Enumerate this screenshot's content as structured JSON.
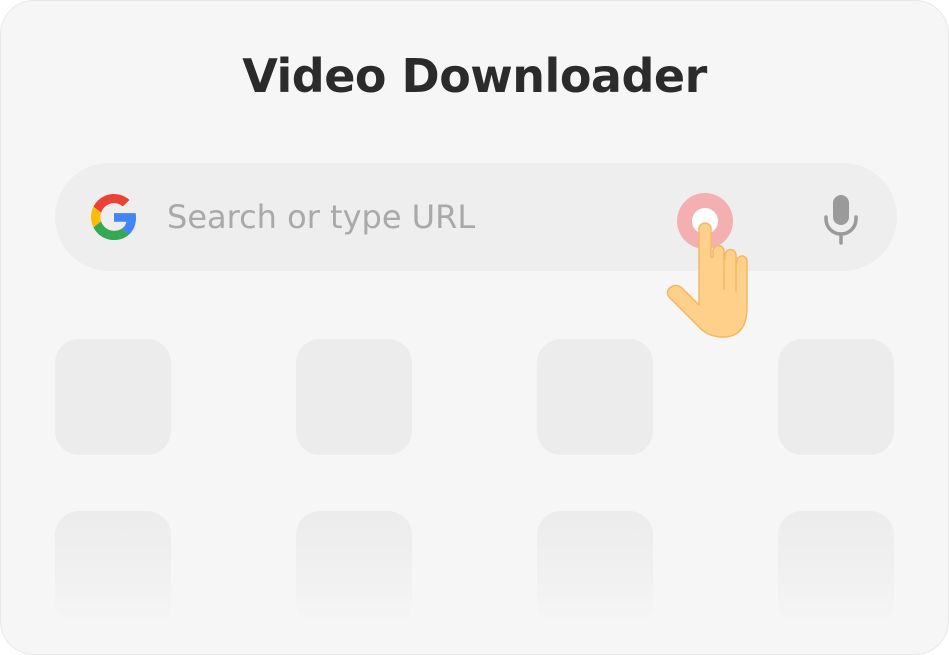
{
  "app": {
    "title": "Video Downloader"
  },
  "search": {
    "placeholder": "Search or type URL",
    "value": "",
    "leading_icon": "google-g-icon",
    "trailing_icon": "microphone-icon"
  },
  "tap_hint": {
    "icon": "hand-pointer-icon",
    "ring_color": "#f4a9a9",
    "hand_color": "#ffd08a"
  },
  "shortcuts": {
    "row1": [
      "",
      "",
      "",
      ""
    ],
    "row2": [
      "",
      "",
      "",
      ""
    ]
  },
  "colors": {
    "background": "#f6f6f6",
    "search_bar": "#eeeeee",
    "tile": "#ececec",
    "title_text": "#2b2b2b",
    "placeholder_text": "#a9a9a9",
    "google_blue": "#4285F4",
    "google_red": "#EA4335",
    "google_yellow": "#FBBC05",
    "google_green": "#34A853"
  }
}
